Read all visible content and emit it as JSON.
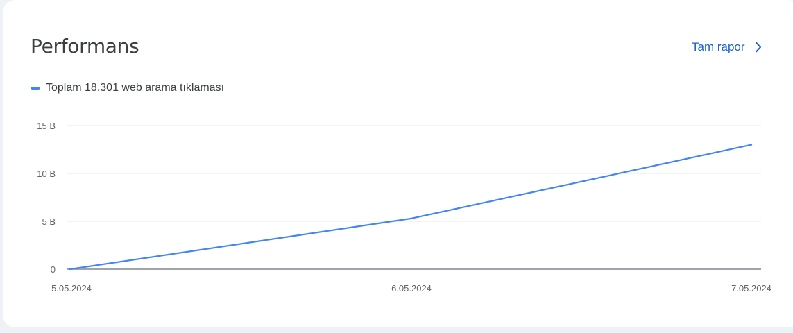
{
  "card": {
    "title": "Performans",
    "report_link": "Tam rapor",
    "report_icon": "chevron-right-icon"
  },
  "chart_data": {
    "type": "line",
    "legend_placement": "top-left",
    "grid": true,
    "x": [
      "5.05.2024",
      "6.05.2024",
      "7.05.2024"
    ],
    "series": [
      {
        "name": "Toplam 18.301 web arama tıklaması",
        "color": "#4285f4",
        "values": [
          0,
          5300000000,
          13000000000
        ]
      }
    ],
    "ylim": [
      0,
      15000000000
    ],
    "yticks": [
      0,
      5000000000,
      10000000000,
      15000000000
    ],
    "ytick_labels": [
      "0",
      "5 B",
      "10 B",
      "15 B"
    ]
  },
  "colors": {
    "accent": "#1a5fd0",
    "line": "#4285f4"
  }
}
